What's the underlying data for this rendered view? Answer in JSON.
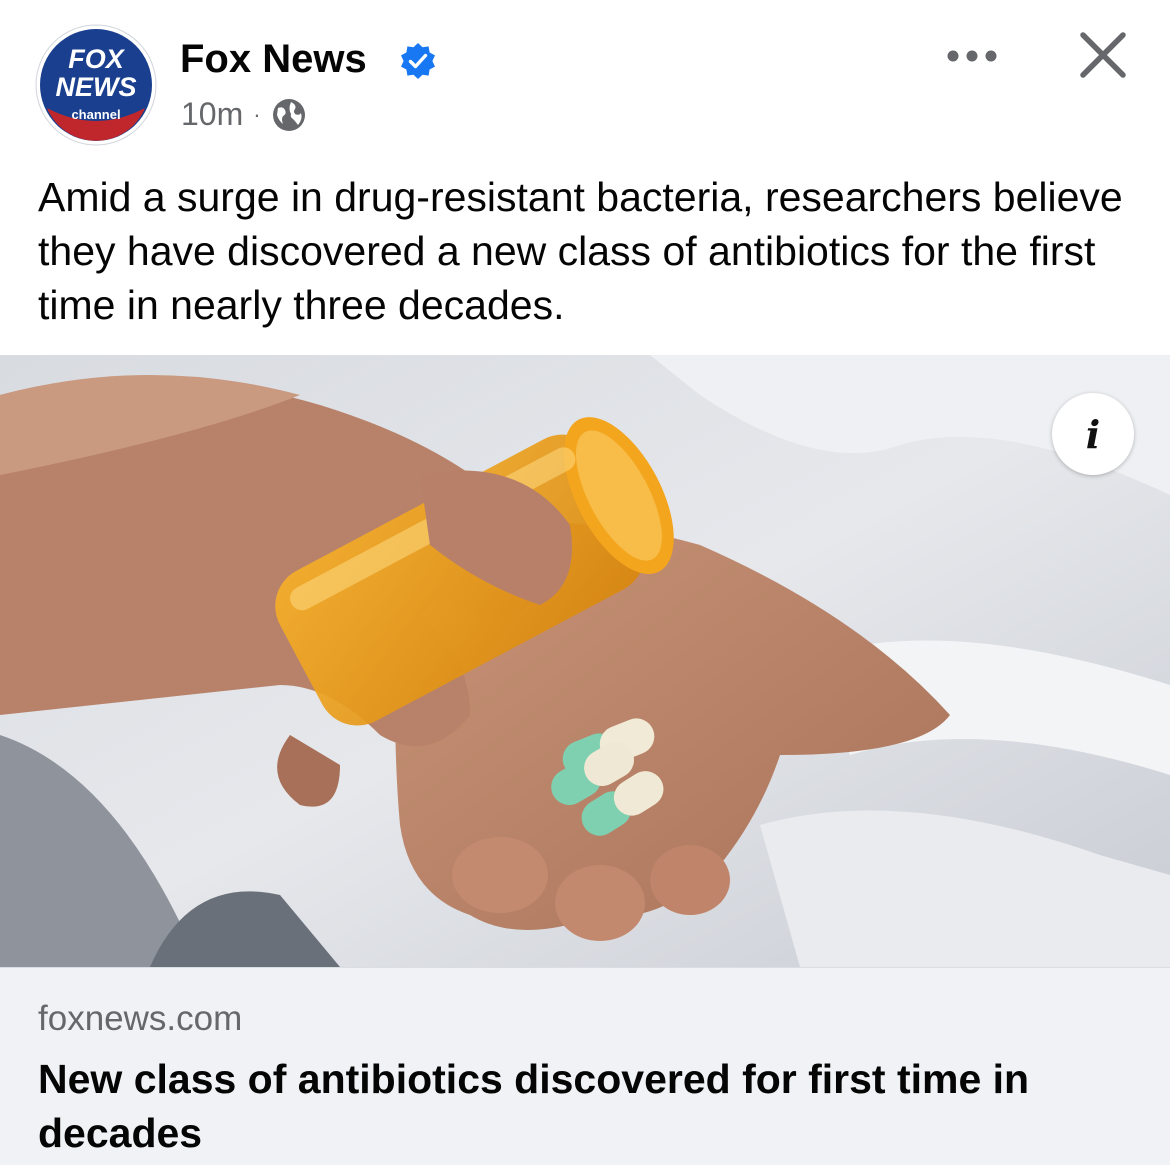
{
  "post": {
    "page_name": "Fox News",
    "time": "10m",
    "separator": "·",
    "caption": "Amid a surge in drug-resistant bacteria, researchers believe they have discovered a new class of antibiotics for the first time in nearly three decades.",
    "avatar_text": {
      "line1": "FOX",
      "line2": "NEWS",
      "line3": "channel"
    },
    "icons": {
      "verified": "verified-badge-icon",
      "audience": "globe-icon",
      "more": "more-options-icon",
      "close": "close-icon",
      "info": "info-icon"
    },
    "info_glyph": "i"
  },
  "link_preview": {
    "domain": "foxnews.com",
    "title": "New class of antibiotics discovered for first time in decades"
  },
  "colors": {
    "verified": "#1877f2",
    "secondary_text": "#65676b",
    "link_bg": "#f0f2f5",
    "fox_blue": "#1a3f8f",
    "fox_red": "#c0272d"
  }
}
